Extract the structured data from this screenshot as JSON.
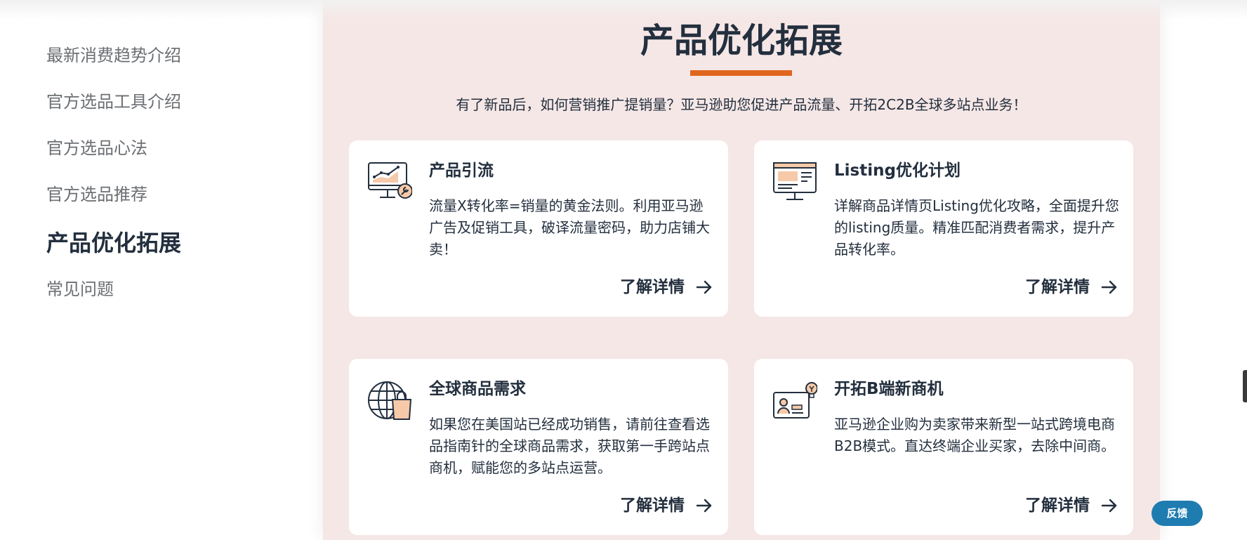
{
  "sidebar": {
    "items": [
      {
        "label": "最新消费趋势介绍"
      },
      {
        "label": "官方选品工具介绍"
      },
      {
        "label": "官方选品心法"
      },
      {
        "label": "官方选品推荐"
      },
      {
        "label": "产品优化拓展",
        "active": true
      },
      {
        "label": "常见问题"
      }
    ]
  },
  "main": {
    "heading": "产品优化拓展",
    "subtitle": "有了新品后，如何营销推广提销量？亚马逊助您促进产品流量、开拓2C2B全球多站点业务！",
    "cards": [
      {
        "icon": "monitor-chart-wrench-icon",
        "title": "产品引流",
        "desc": "流量X转化率=销量的黄金法则。利用亚马逊广告及促销工具，破译流量密码，助力店铺大卖！",
        "link": "了解详情"
      },
      {
        "icon": "monitor-layout-icon",
        "title": "Listing优化计划",
        "desc": "详解商品详情页Listing优化攻略，全面提升您的listing质量。精准匹配消费者需求，提升产品转化率。",
        "link": "了解详情"
      },
      {
        "icon": "globe-shopping-bag-icon",
        "title": "全球商品需求",
        "desc": "如果您在美国站已经成功销售，请前往查看选品指南针的全球商品需求，获取第一手跨站点商机，赋能您的多站点运营。",
        "link": "了解详情"
      },
      {
        "icon": "business-card-lightbulb-icon",
        "title": "开拓B端新商机",
        "desc": "亚马逊企业购为卖家带来新型一站式跨境电商B2B模式。直达终端企业买家，去除中间商。",
        "link": "了解详情"
      }
    ]
  },
  "feedback_label": "反馈",
  "colors": {
    "accent": "#e0661f",
    "text": "#232f3e",
    "panel_bg": "#f5e7e6",
    "feedback_bg": "#1e7cb0"
  }
}
